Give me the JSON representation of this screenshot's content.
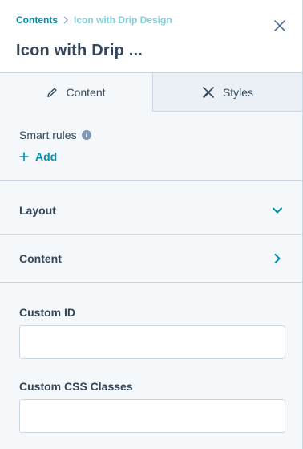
{
  "header": {
    "breadcrumb_root": "Contents",
    "breadcrumb_current": "Icon with Drip Design",
    "title": "Icon with Drip ..."
  },
  "tabs": [
    {
      "label": "Content",
      "icon": "pencil-icon",
      "active": true
    },
    {
      "label": "Styles",
      "icon": "styles-tools-icon",
      "active": false
    }
  ],
  "smart_rules": {
    "label": "Smart rules",
    "add_label": "Add"
  },
  "sections": [
    {
      "label": "Layout",
      "icon": "chevron-down-icon"
    },
    {
      "label": "Content",
      "icon": "chevron-right-icon"
    }
  ],
  "fields": {
    "custom_id": {
      "label": "Custom ID",
      "value": "",
      "placeholder": ""
    },
    "custom_css": {
      "label": "Custom CSS Classes",
      "value": "",
      "placeholder": ""
    }
  },
  "colors": {
    "accent": "#0091ae",
    "text": "#33475b",
    "border": "#cbd6e2",
    "panel_bg": "#f5f8fa",
    "inactive_tab_bg": "#eaf0f6"
  }
}
